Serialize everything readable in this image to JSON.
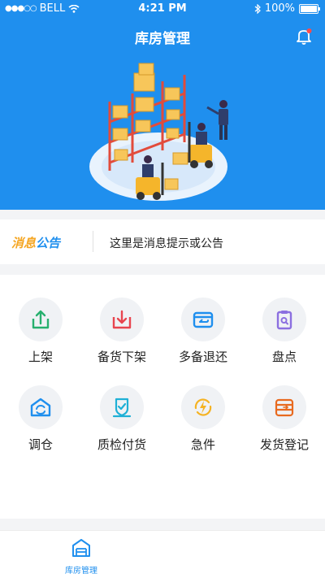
{
  "status": {
    "carrier": "BELL",
    "time": "4:21 PM",
    "battery": "100%"
  },
  "header": {
    "title": "库房管理"
  },
  "notice": {
    "tag_part1": "消息",
    "tag_part2": "公告",
    "message": "这里是消息提示或公告"
  },
  "actions": [
    {
      "label": "上架",
      "icon": "upload-tray-icon",
      "color": "#27b06e"
    },
    {
      "label": "备货下架",
      "icon": "download-tray-icon",
      "color": "#e8454f"
    },
    {
      "label": "多备退还",
      "icon": "return-box-icon",
      "color": "#1f8fee"
    },
    {
      "label": "盘点",
      "icon": "clipboard-search-icon",
      "color": "#8b6fe0"
    },
    {
      "label": "调仓",
      "icon": "warehouse-sync-icon",
      "color": "#1f8fee"
    },
    {
      "label": "质检付货",
      "icon": "quality-check-icon",
      "color": "#1fb0d6"
    },
    {
      "label": "急件",
      "icon": "urgent-bolt-icon",
      "color": "#f5b323"
    },
    {
      "label": "发货登记",
      "icon": "shipping-register-icon",
      "color": "#e86a1f"
    }
  ],
  "tabbar": {
    "tab1_label": "库房管理"
  }
}
